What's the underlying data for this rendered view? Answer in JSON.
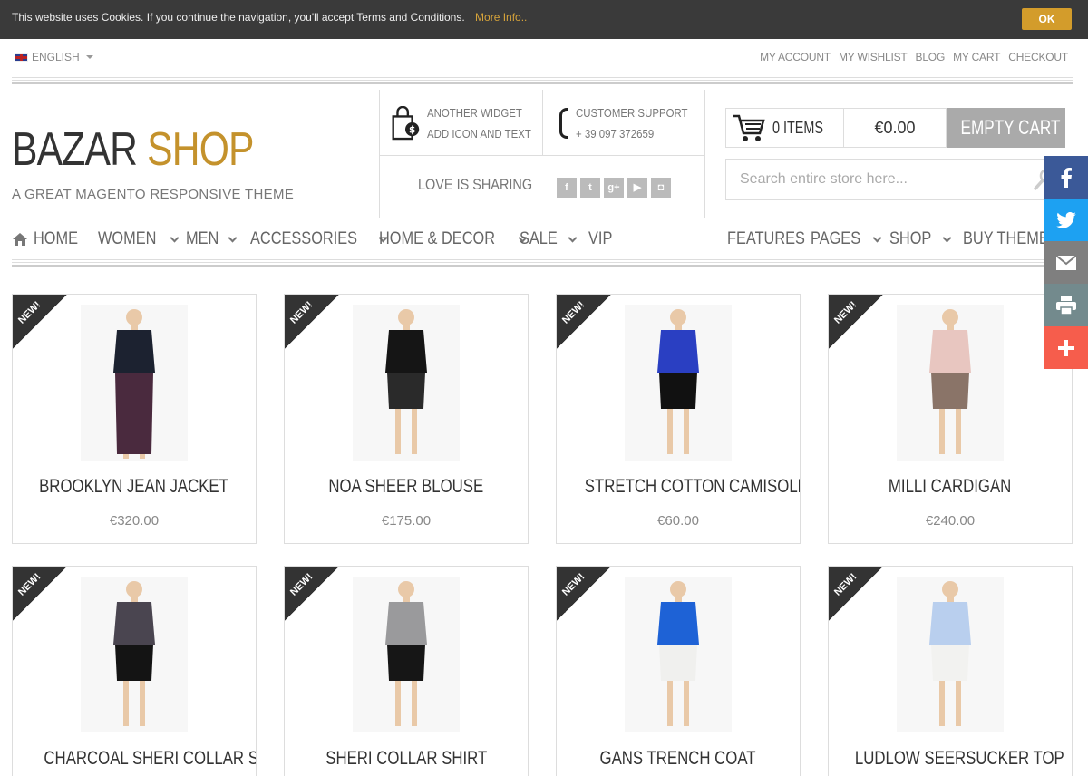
{
  "cookie": {
    "message": "This website uses Cookies. If you continue the navigation, you'll accept Terms and Conditions.",
    "more_link": "More Info..",
    "ok_button": "OK"
  },
  "topbar": {
    "language": "ENGLISH",
    "links": [
      "MY ACCOUNT",
      "MY WISHLIST",
      "BLOG",
      "MY CART",
      "CHECKOUT"
    ]
  },
  "header": {
    "logo_part1": "BAZAR",
    "logo_part2": "SHOP",
    "tagline": "A GREAT MAGENTO RESPONSIVE THEME",
    "widget1_line1": "ANOTHER WIDGET",
    "widget1_line2": "ADD ICON AND TEXT",
    "widget2_line1": "CUSTOMER SUPPORT",
    "widget2_line2": "+ 39 097 372659",
    "love_sharing": "LOVE IS SHARING",
    "social_icons": [
      "facebook-icon",
      "twitter-icon",
      "google-plus-icon",
      "youtube-icon",
      "instagram-icon"
    ]
  },
  "cart": {
    "items_label": "0 ITEMS",
    "total": "€0.00",
    "empty_button": "EMPTY CART"
  },
  "search": {
    "placeholder": "Search entire store here..."
  },
  "nav": {
    "left": [
      {
        "label": "HOME",
        "dropdown": false
      },
      {
        "label": "WOMEN",
        "dropdown": true
      },
      {
        "label": "MEN",
        "dropdown": true
      },
      {
        "label": "ACCESSORIES",
        "dropdown": true
      },
      {
        "label": "HOME & DECOR",
        "dropdown": true
      },
      {
        "label": "SALE",
        "dropdown": true
      },
      {
        "label": "VIP",
        "dropdown": false
      }
    ],
    "right": [
      {
        "label": "FEATURES",
        "dropdown": false
      },
      {
        "label": "PAGES",
        "dropdown": true
      },
      {
        "label": "SHOP",
        "dropdown": true
      },
      {
        "label": "BUY THEME",
        "dropdown": false
      }
    ]
  },
  "products": [
    {
      "badge": "NEW!",
      "name": "BROOKLYN JEAN JACKET",
      "price": "€320.00",
      "colors": {
        "top": "#1c2230",
        "bottom": "#4a2a3e"
      }
    },
    {
      "badge": "NEW!",
      "name": "NOA SHEER BLOUSE",
      "price": "€175.00",
      "colors": {
        "top": "#151515",
        "bottom": "#2a2a2a"
      }
    },
    {
      "badge": "NEW!",
      "name": "STRETCH COTTON CAMISOLE",
      "price": "€60.00",
      "colors": {
        "top": "#2a3fc2",
        "bottom": "#111111"
      }
    },
    {
      "badge": "NEW!",
      "name": "MILLI CARDIGAN",
      "price": "€240.00",
      "colors": {
        "top": "#e8c6c0",
        "bottom": "#8a7468"
      }
    },
    {
      "badge": "NEW!",
      "name": "CHARCOAL SHERI COLLAR SHIRT",
      "price": "",
      "colors": {
        "top": "#4a4550",
        "bottom": "#141414"
      }
    },
    {
      "badge": "NEW!",
      "name": "SHERI COLLAR SHIRT",
      "price": "",
      "colors": {
        "top": "#9a9a9c",
        "bottom": "#161616"
      }
    },
    {
      "badge": "NEW!",
      "name": "GANS TRENCH COAT",
      "price": "",
      "colors": {
        "top": "#1e62d6",
        "bottom": "#f0f0ee"
      }
    },
    {
      "badge": "NEW!",
      "name": "LUDLOW SEERSUCKER TOP",
      "price": "",
      "colors": {
        "top": "#b9cfee",
        "bottom": "#f2f2f0"
      }
    }
  ],
  "share_sidebar": [
    {
      "icon": "facebook-icon",
      "color": "#3b5998"
    },
    {
      "icon": "twitter-icon",
      "color": "#1da1f2"
    },
    {
      "icon": "email-icon",
      "color": "#7f7f7f"
    },
    {
      "icon": "print-icon",
      "color": "#738a8d"
    },
    {
      "icon": "plus-icon",
      "color": "#f65d4c"
    }
  ]
}
